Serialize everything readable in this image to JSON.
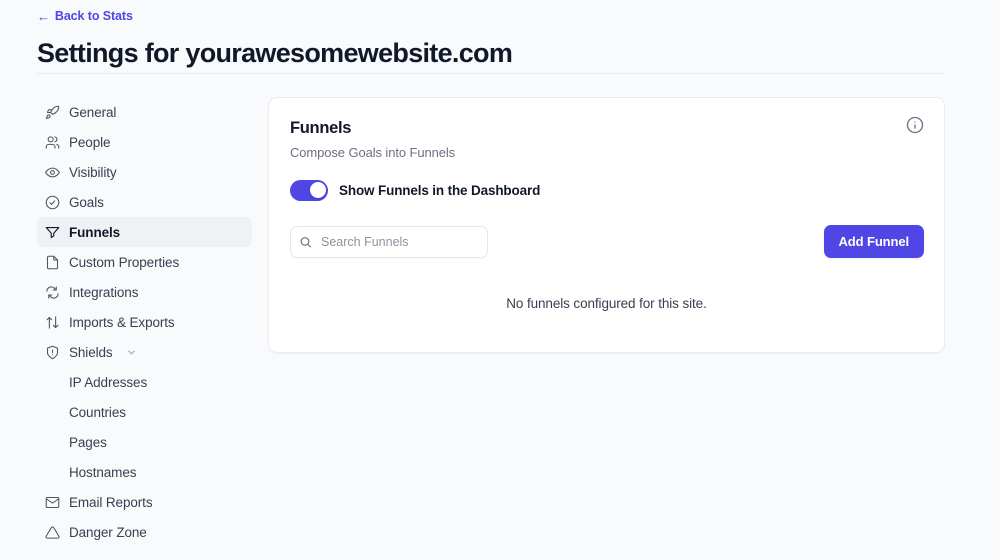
{
  "header": {
    "back_link": "Back to Stats",
    "back_arrow": "←",
    "title": "Settings for yourawesomewebsite.com"
  },
  "colors": {
    "accent": "#4f46e5",
    "page_background": "#f8fafc",
    "panel_background": "#ffffff",
    "active_nav_background": "#f0f1f5",
    "muted_text": "#6b7280"
  },
  "sidebar": {
    "items": [
      {
        "label": "General",
        "icon": "rocket-icon",
        "active": false
      },
      {
        "label": "People",
        "icon": "people-icon",
        "active": false
      },
      {
        "label": "Visibility",
        "icon": "eye-icon",
        "active": false
      },
      {
        "label": "Goals",
        "icon": "check-circle-icon",
        "active": false
      },
      {
        "label": "Funnels",
        "icon": "funnel-icon",
        "active": true
      },
      {
        "label": "Custom Properties",
        "icon": "document-icon",
        "active": false
      },
      {
        "label": "Integrations",
        "icon": "sync-icon",
        "active": false
      },
      {
        "label": "Imports & Exports",
        "icon": "arrows-up-down-icon",
        "active": false
      },
      {
        "label": "Shields",
        "icon": "shield-icon",
        "active": false,
        "expandable": true
      }
    ],
    "shields_children": [
      {
        "label": "IP Addresses"
      },
      {
        "label": "Countries"
      },
      {
        "label": "Pages"
      },
      {
        "label": "Hostnames"
      }
    ],
    "trailing_items": [
      {
        "label": "Email Reports",
        "icon": "envelope-icon"
      },
      {
        "label": "Danger Zone",
        "icon": "warning-triangle-icon"
      }
    ]
  },
  "panel": {
    "title": "Funnels",
    "subtitle": "Compose Goals into Funnels",
    "info_icon": "info-circle-icon",
    "toggle": {
      "label": "Show Funnels in the Dashboard",
      "state": "on"
    },
    "search": {
      "placeholder": "Search Funnels",
      "value": "",
      "icon": "search-icon"
    },
    "add_button": "Add Funnel",
    "empty_state": "No funnels configured for this site."
  }
}
